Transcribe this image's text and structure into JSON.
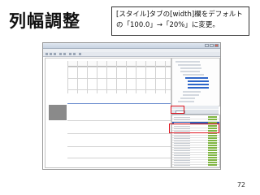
{
  "slide": {
    "title": "列幅調整",
    "callout_line1": "[スタイル]タブの[width]欄をデフォルト",
    "callout_line2": "の「100.0」→「20%」に変更。",
    "page_number": "72"
  },
  "screenshot": {
    "window_title": "",
    "menus": [
      "",
      "",
      "",
      "",
      "",
      "",
      ""
    ],
    "tab_label": "",
    "colors": {
      "highlight_red": "#e0141e",
      "selection_blue": "#2f67c9",
      "value_green": "#7fb542"
    }
  }
}
